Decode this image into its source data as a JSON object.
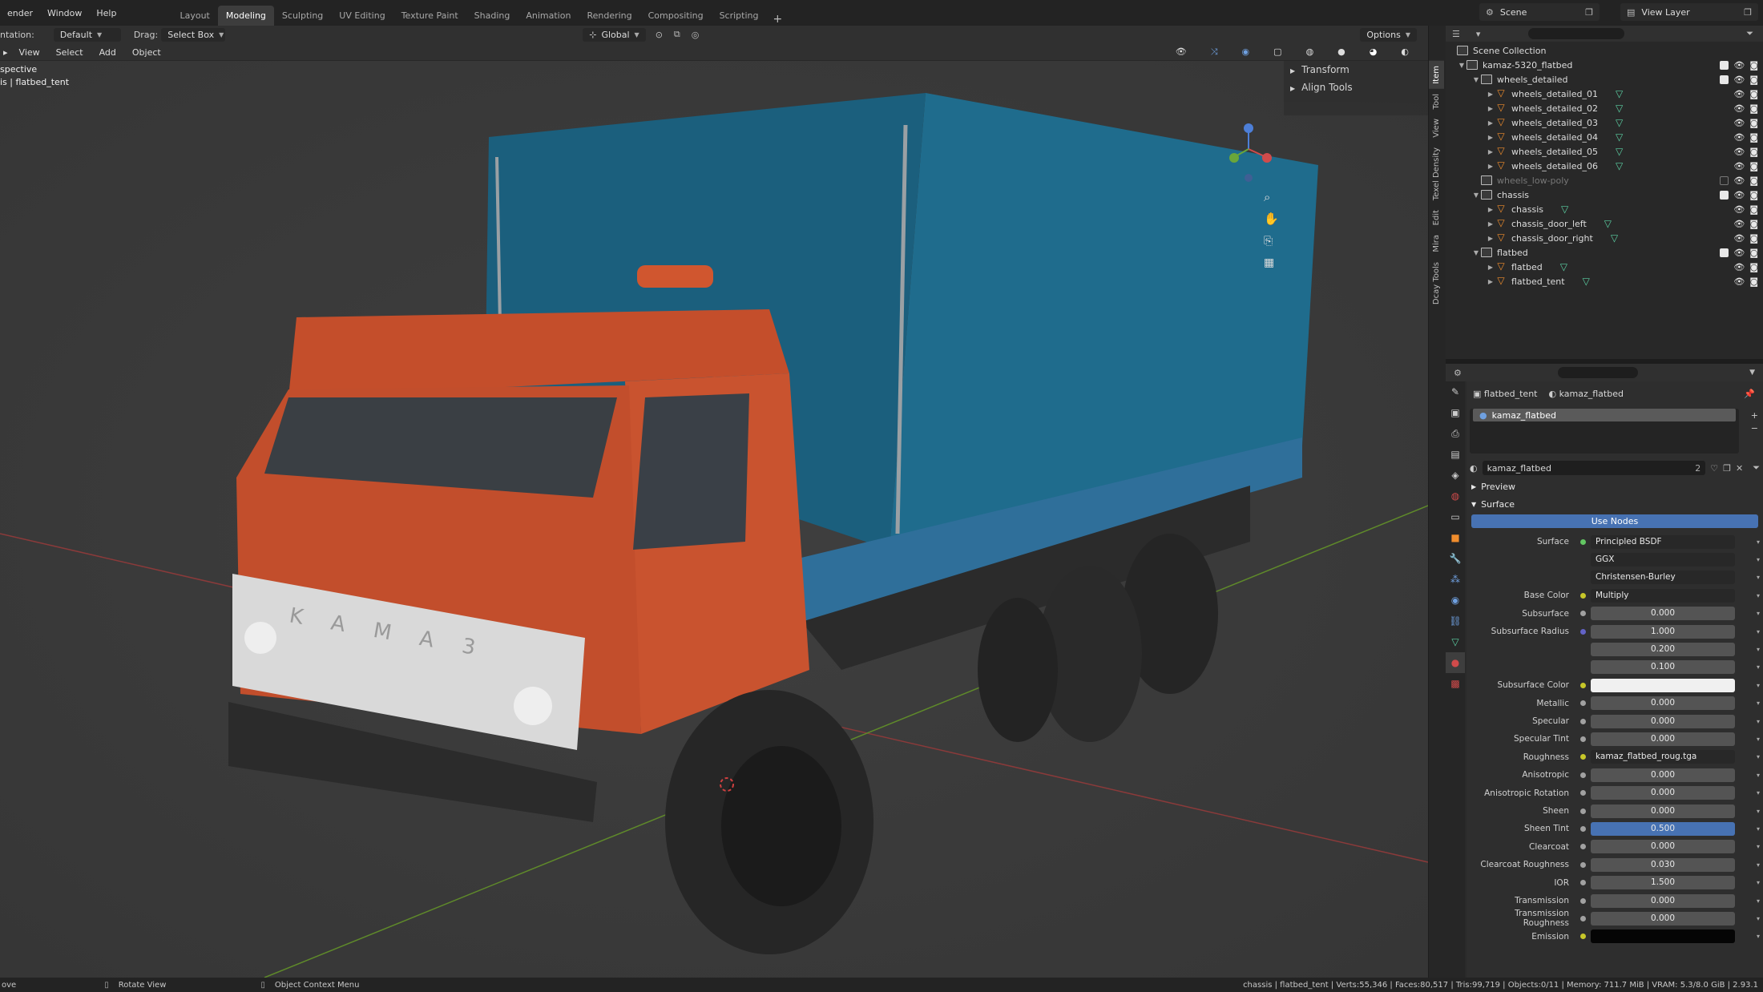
{
  "menu": [
    "ender",
    "Window",
    "Help"
  ],
  "workspaces": [
    "Layout",
    "Modeling",
    "Sculpting",
    "UV Editing",
    "Texture Paint",
    "Shading",
    "Animation",
    "Rendering",
    "Compositing",
    "Scripting"
  ],
  "active_workspace": "Modeling",
  "plus": "+",
  "scene": "Scene",
  "view_layer": "View Layer",
  "viewport_header": {
    "orientation_label": "ntation:",
    "orientation_value": "Default",
    "drag_label": "Drag:",
    "drag_value": "Select Box",
    "transform_orientation": "Global",
    "options": "Options",
    "menus": [
      "View",
      "Select",
      "Add",
      "Object"
    ]
  },
  "viewport_overlay": {
    "line1": "spective",
    "line2": "is | flatbed_tent"
  },
  "npanel": {
    "transform": "Transform",
    "align": "Align Tools"
  },
  "sidebar_tabs": [
    "Item",
    "Tool",
    "View",
    "Texel Density",
    "Edit",
    "Mira",
    "Dcay Tools"
  ],
  "outliner": {
    "root": "Scene Collection",
    "rows": [
      {
        "label": "kamaz-5320_flatbed",
        "level": 0,
        "kind": "coll",
        "checked": true
      },
      {
        "label": "wheels_detailed",
        "level": 1,
        "kind": "coll",
        "checked": true
      },
      {
        "label": "wheels_detailed_01",
        "level": 2,
        "kind": "obj"
      },
      {
        "label": "wheels_detailed_02",
        "level": 2,
        "kind": "obj"
      },
      {
        "label": "wheels_detailed_03",
        "level": 2,
        "kind": "obj"
      },
      {
        "label": "wheels_detailed_04",
        "level": 2,
        "kind": "obj"
      },
      {
        "label": "wheels_detailed_05",
        "level": 2,
        "kind": "obj"
      },
      {
        "label": "wheels_detailed_06",
        "level": 2,
        "kind": "obj"
      },
      {
        "label": "wheels_low-poly",
        "level": 1,
        "kind": "coll",
        "checked": false,
        "dim": true
      },
      {
        "label": "chassis",
        "level": 1,
        "kind": "coll",
        "checked": true
      },
      {
        "label": "chassis",
        "level": 2,
        "kind": "obj"
      },
      {
        "label": "chassis_door_left",
        "level": 2,
        "kind": "obj"
      },
      {
        "label": "chassis_door_right",
        "level": 2,
        "kind": "obj"
      },
      {
        "label": "flatbed",
        "level": 1,
        "kind": "coll",
        "checked": true
      },
      {
        "label": "flatbed",
        "level": 2,
        "kind": "obj"
      },
      {
        "label": "flatbed_tent",
        "level": 2,
        "kind": "obj"
      }
    ]
  },
  "properties": {
    "crumb_object": "flatbed_tent",
    "crumb_material": "kamaz_flatbed",
    "slot": "kamaz_flatbed",
    "material_name": "kamaz_flatbed",
    "material_users": "2",
    "preview": "Preview",
    "surface_section": "Surface",
    "use_nodes": "Use Nodes",
    "rows": [
      {
        "label": "Surface",
        "value": "Principled BSDF",
        "type": "link",
        "dot": "g"
      },
      {
        "label": "",
        "value": "GGX",
        "type": "dark"
      },
      {
        "label": "",
        "value": "Christensen-Burley",
        "type": "dark"
      },
      {
        "label": "Base Color",
        "value": "Multiply",
        "type": "link",
        "dot": "y"
      },
      {
        "label": "Subsurface",
        "value": "0.000",
        "type": "num"
      },
      {
        "label": "Subsurface Radius",
        "value": "1.000",
        "type": "num",
        "dot": "b"
      },
      {
        "label": "",
        "value": "0.200",
        "type": "num",
        "nodot": true
      },
      {
        "label": "",
        "value": "0.100",
        "type": "num",
        "nodot": true
      },
      {
        "label": "Subsurface Color",
        "value": "",
        "type": "white",
        "dot": "y"
      },
      {
        "label": "Metallic",
        "value": "0.000",
        "type": "num"
      },
      {
        "label": "Specular",
        "value": "0.000",
        "type": "num"
      },
      {
        "label": "Specular Tint",
        "value": "0.000",
        "type": "num"
      },
      {
        "label": "Roughness",
        "value": "kamaz_flatbed_roug.tga",
        "type": "link",
        "dot": "y"
      },
      {
        "label": "Anisotropic",
        "value": "0.000",
        "type": "num"
      },
      {
        "label": "Anisotropic Rotation",
        "value": "0.000",
        "type": "num"
      },
      {
        "label": "Sheen",
        "value": "0.000",
        "type": "num"
      },
      {
        "label": "Sheen Tint",
        "value": "0.500",
        "type": "blue"
      },
      {
        "label": "Clearcoat",
        "value": "0.000",
        "type": "num"
      },
      {
        "label": "Clearcoat Roughness",
        "value": "0.030",
        "type": "num"
      },
      {
        "label": "IOR",
        "value": "1.500",
        "type": "num"
      },
      {
        "label": "Transmission",
        "value": "0.000",
        "type": "num"
      },
      {
        "label": "Transmission Roughness",
        "value": "0.000",
        "type": "num"
      },
      {
        "label": "Emission",
        "value": "",
        "type": "black",
        "dot": "y"
      }
    ]
  },
  "statusbar": {
    "left": "ove",
    "rotate": "Rotate View",
    "context": "Object Context Menu",
    "stats": "chassis | flatbed_tent | Verts:55,346 | Faces:80,517 | Tris:99,719 | Objects:0/11 | Memory: 711.7 MiB | VRAM: 5.3/8.0 GiB | 2.93.1"
  },
  "truck_text": "KAMA3",
  "colors": {
    "cab": "#c8522e",
    "tent": "#1e6585",
    "bed": "#2f6f9a",
    "accent": "#4772b3"
  }
}
